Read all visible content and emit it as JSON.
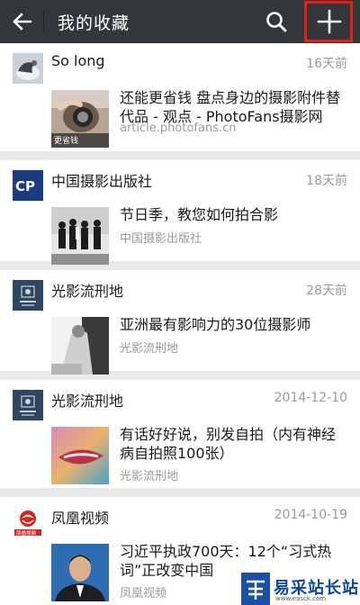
{
  "header": {
    "title": "我的收藏",
    "back_icon": "back-arrow-icon",
    "search_icon": "search-icon",
    "add_icon": "plus-icon",
    "background": "#33373a",
    "annotation_color": "#e0201c"
  },
  "favorites": [
    {
      "source": "So long",
      "time": "16天前",
      "headline": "还能更省钱 盘点身边的摄影附件替代品 - 观点 - PhotoFans摄影网",
      "subtitle": "article.photofans.cn",
      "thumb_caption": "更省钱"
    },
    {
      "source": "中国摄影出版社",
      "time": "18天前",
      "headline": "节日季，教您如何拍合影",
      "subtitle": "中国摄影出版社",
      "avatar_text": "CP"
    },
    {
      "source": "光影流刑地",
      "time": "28天前",
      "headline": "亚洲最有影响力的30位摄影师",
      "subtitle": "光影流刑地"
    },
    {
      "source": "光影流刑地",
      "time": "2014-12-10",
      "headline": "有话好好说，别发自拍（内有神经病自拍照100张）",
      "subtitle": "光影流刑地"
    },
    {
      "source": "凤凰视频",
      "time": "2014-10-19",
      "headline": "习近平执政700天：12个“习式热词”正改变中国",
      "subtitle": "凤凰视频",
      "avatar_text": "凤凰视频"
    }
  ],
  "watermark": {
    "brand": "易采站长站",
    "url": "www.easck.com"
  }
}
